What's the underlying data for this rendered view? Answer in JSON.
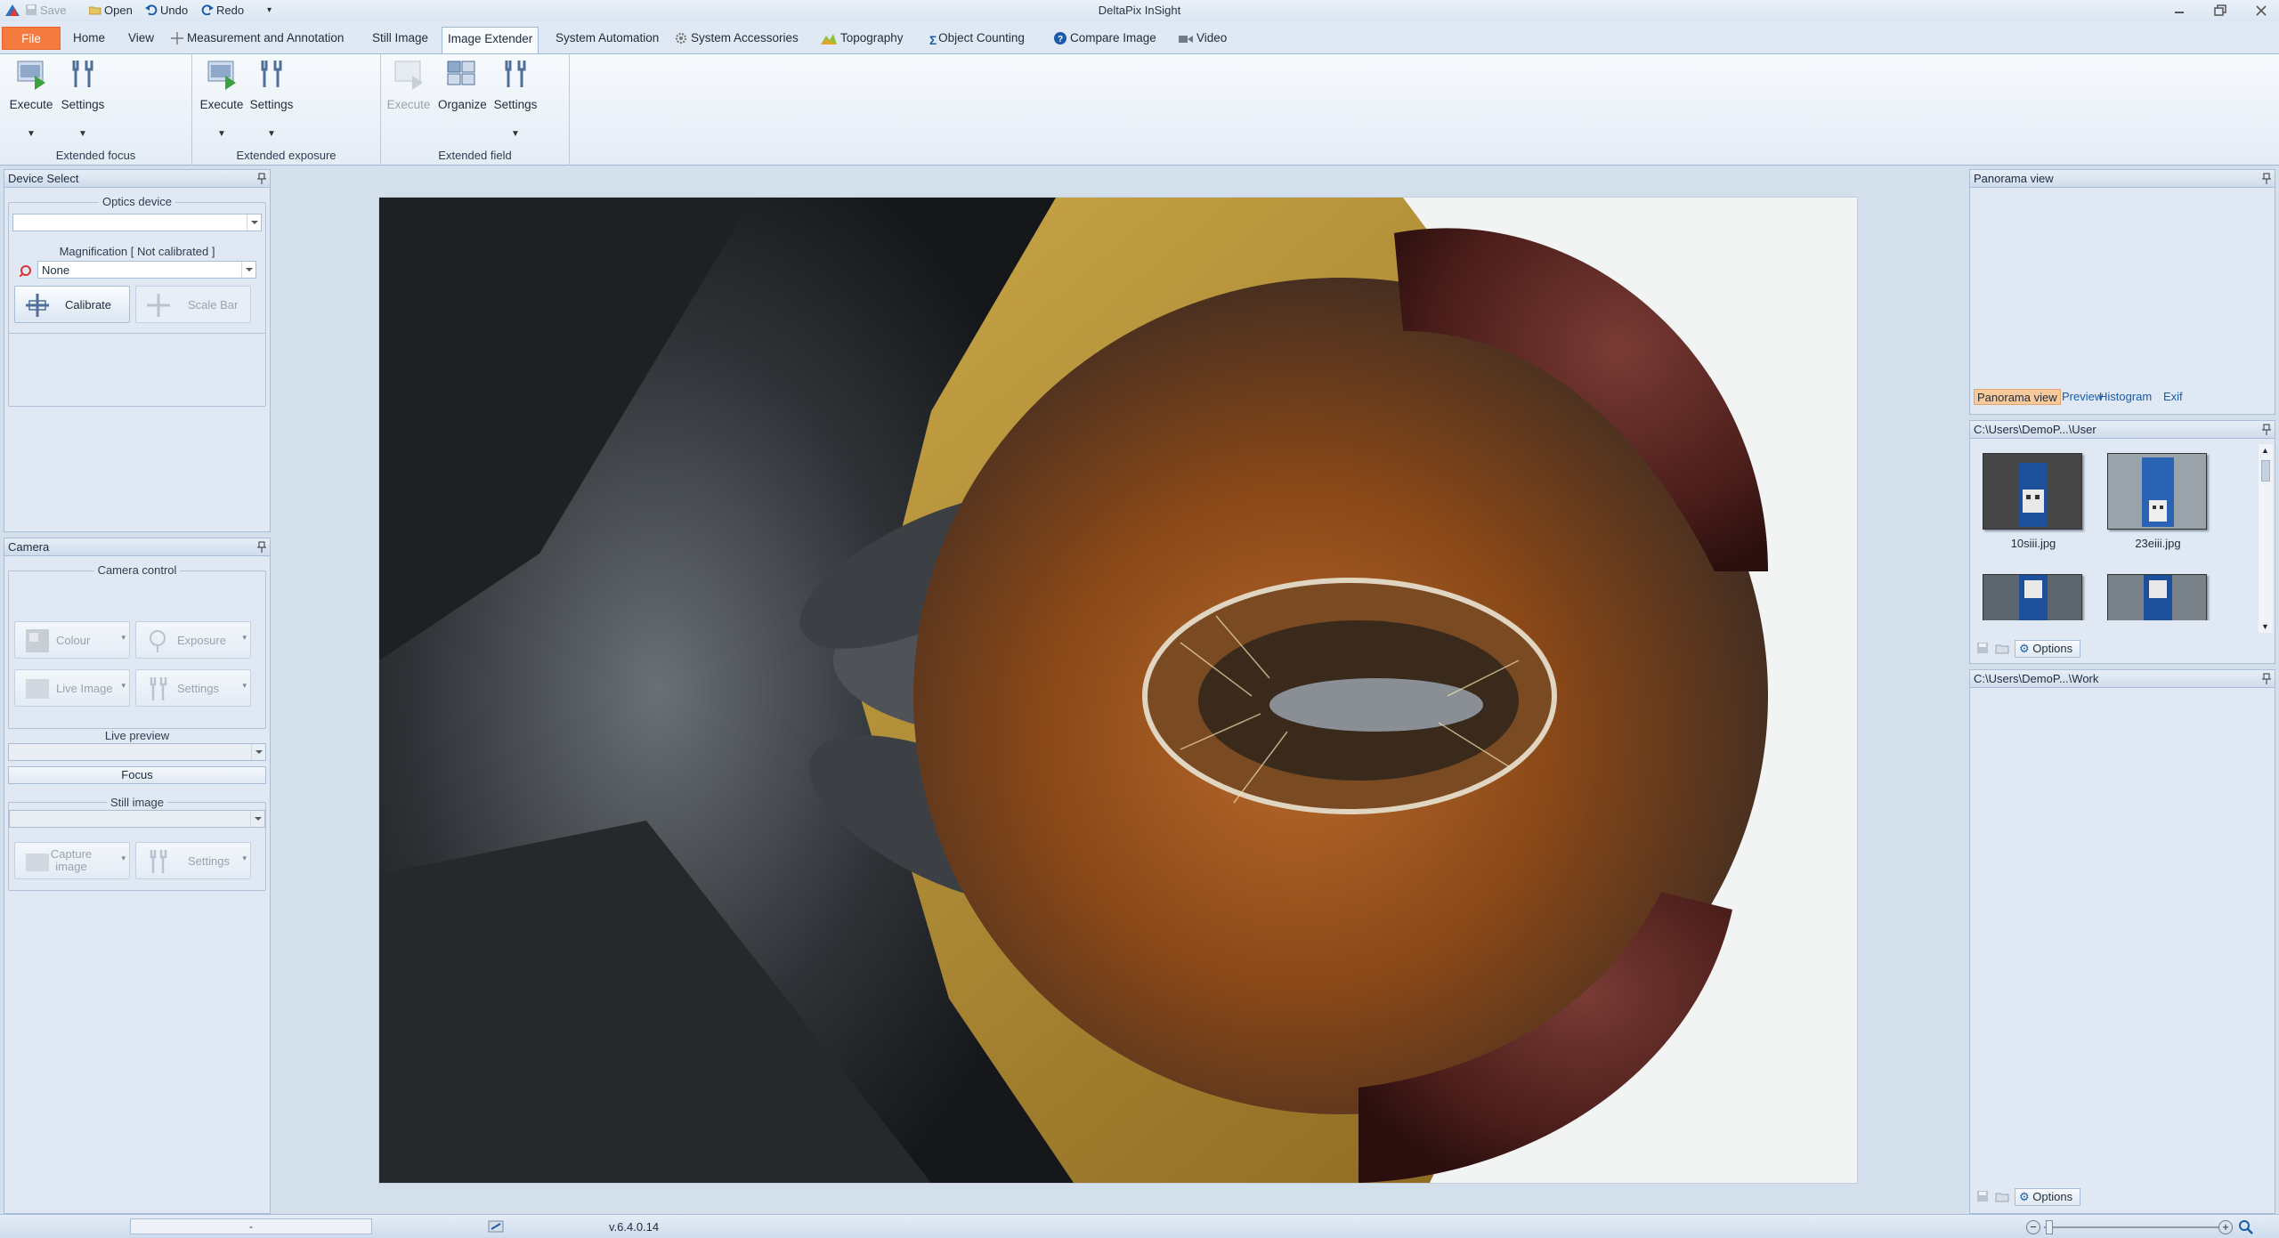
{
  "window": {
    "title": "DeltaPix InSight"
  },
  "quick_access": {
    "save": "Save",
    "open": "Open",
    "undo": "Undo",
    "redo": "Redo"
  },
  "ribbon": {
    "file": "File",
    "tabs": [
      "Home",
      "View",
      "Measurement and Annotation",
      "Still Image",
      "Image Extender",
      "System Automation",
      "System Accessories",
      "Topography",
      "Object Counting",
      "Compare Image",
      "Video"
    ],
    "active_tab": "Image Extender",
    "groups": {
      "focus": {
        "label": "Extended focus",
        "execute": "Execute",
        "settings": "Settings"
      },
      "exposure": {
        "label": "Extended exposure",
        "execute": "Execute",
        "settings": "Settings"
      },
      "field": {
        "label": "Extended field",
        "execute": "Execute",
        "organize": "Organize",
        "settings": "Settings"
      }
    }
  },
  "device_panel": {
    "title": "Device Select",
    "optics_title": "Optics device",
    "optics_value": "",
    "magnification_title": "Magnification [ Not calibrated ]",
    "magnification_value": "None",
    "calibrate": "Calibrate",
    "scale_bar": "Scale Bar"
  },
  "camera_panel": {
    "title": "Camera",
    "control_title": "Camera control",
    "colour": "Colour",
    "exposure": "Exposure",
    "live_image": "Live Image",
    "settings": "Settings",
    "live_preview_title": "Live preview",
    "focus": "Focus",
    "still_image_title": "Still image",
    "capture_image": "Capture image",
    "still_settings": "Settings"
  },
  "right": {
    "panorama_title": "Panorama view",
    "tabs": [
      "Panorama view",
      "Preview",
      "Histogram",
      "Exif"
    ],
    "active_tab": "Panorama view",
    "user_folder": "C:\\Users\\DemoP...\\User",
    "thumbs": [
      "10siii.jpg",
      "23eiii.jpg",
      "",
      ""
    ],
    "options": "Options",
    "work_folder": "C:\\Users\\DemoP...\\Work",
    "work_options": "Options"
  },
  "status": {
    "version": "v.6.4.0.14",
    "left_field": "-"
  },
  "colors": {
    "file_tab": "#f47a40",
    "accent_blue": "#1b5ca8",
    "panel_bg": "#dfe8f3"
  }
}
